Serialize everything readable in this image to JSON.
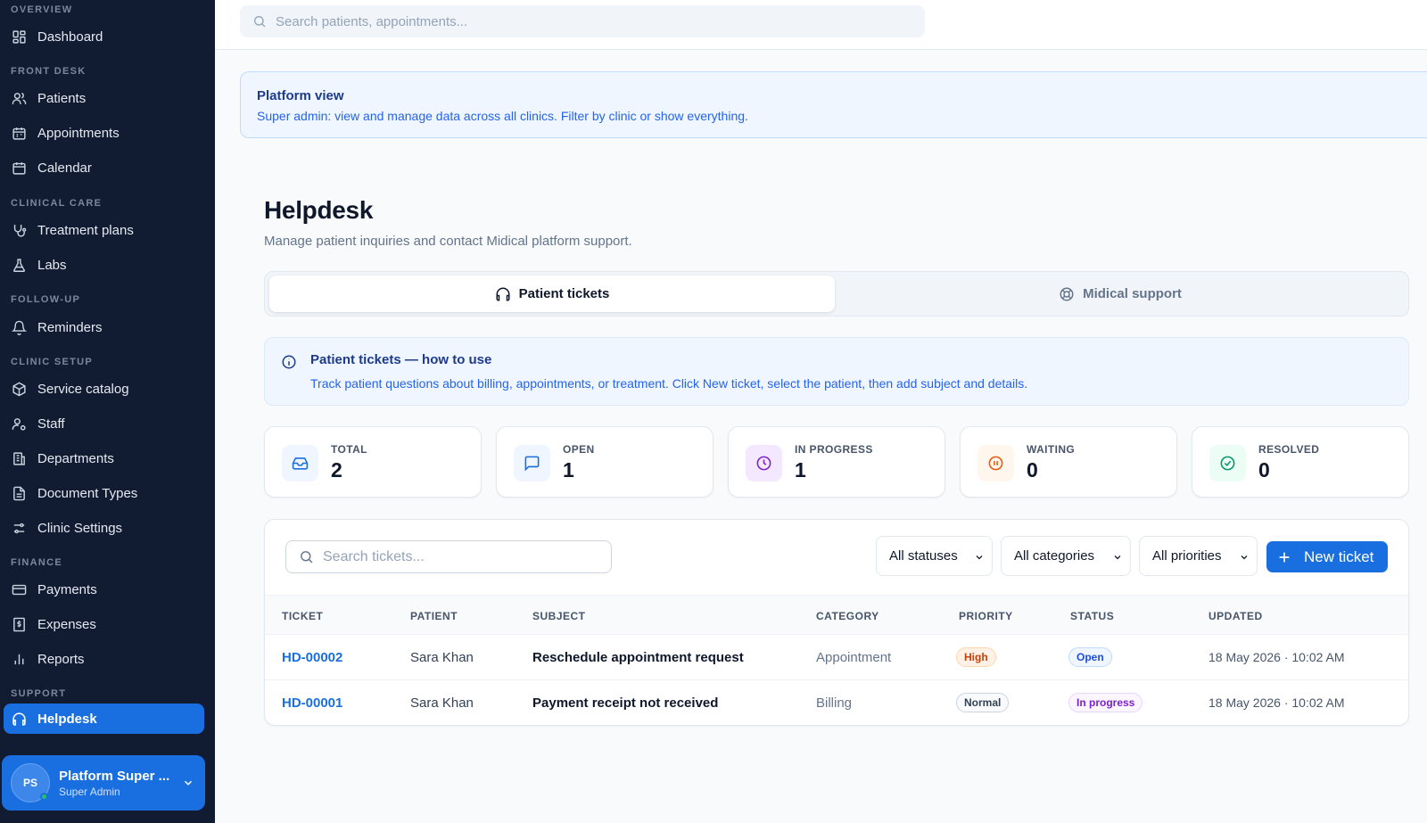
{
  "sidebar": {
    "sections": {
      "overview": "OVERVIEW",
      "front_desk": "FRONT DESK",
      "clinical_care": "CLINICAL CARE",
      "follow_up": "FOLLOW-UP",
      "clinic_setup": "CLINIC SETUP",
      "finance": "FINANCE",
      "support": "SUPPORT"
    },
    "items": {
      "dashboard": "Dashboard",
      "patients": "Patients",
      "appointments": "Appointments",
      "calendar": "Calendar",
      "treatment_plans": "Treatment plans",
      "labs": "Labs",
      "reminders": "Reminders",
      "service_catalog": "Service catalog",
      "staff": "Staff",
      "departments": "Departments",
      "document_types": "Document Types",
      "clinic_settings": "Clinic Settings",
      "payments": "Payments",
      "expenses": "Expenses",
      "reports": "Reports",
      "helpdesk": "Helpdesk"
    },
    "user": {
      "initials": "PS",
      "name": "Platform Super ...",
      "role": "Super Admin"
    }
  },
  "topbar": {
    "search_placeholder": "Search patients, appointments..."
  },
  "platform_banner": {
    "title": "Platform view",
    "description": "Super admin: view and manage data across all clinics. Filter by clinic or show everything."
  },
  "page": {
    "title": "Helpdesk",
    "subtitle": "Manage patient inquiries and contact Midical platform support."
  },
  "tabs": {
    "patient_tickets": "Patient tickets",
    "midical_support": "Midical support"
  },
  "info": {
    "title": "Patient tickets — how to use",
    "description": "Track patient questions about billing, appointments, or treatment. Click New ticket, select the patient, then add subject and details."
  },
  "stats": {
    "total": {
      "label": "TOTAL",
      "value": "2"
    },
    "open": {
      "label": "OPEN",
      "value": "1"
    },
    "in_progress": {
      "label": "IN PROGRESS",
      "value": "1"
    },
    "waiting": {
      "label": "WAITING",
      "value": "0"
    },
    "resolved": {
      "label": "RESOLVED",
      "value": "0"
    }
  },
  "toolbar": {
    "search_placeholder": "Search tickets...",
    "status_filter": "All statuses",
    "category_filter": "All categories",
    "priority_filter": "All priorities",
    "new_ticket": "New ticket"
  },
  "table": {
    "headers": {
      "ticket": "TICKET",
      "patient": "PATIENT",
      "subject": "SUBJECT",
      "category": "CATEGORY",
      "priority": "PRIORITY",
      "status": "STATUS",
      "updated": "UPDATED"
    },
    "rows": [
      {
        "ticket": "HD-00002",
        "patient": "Sara Khan",
        "subject": "Reschedule appointment request",
        "category": "Appointment",
        "priority": "High",
        "status": "Open",
        "updated": "18 May 2026 · 10:02 AM"
      },
      {
        "ticket": "HD-00001",
        "patient": "Sara Khan",
        "subject": "Payment receipt not received",
        "category": "Billing",
        "priority": "Normal",
        "status": "In progress",
        "updated": "18 May 2026 · 10:02 AM"
      }
    ]
  },
  "colors": {
    "sidebar_bg": "#111c33",
    "accent": "#1a6fe0",
    "priority_high": "#c2410c",
    "status_open": "#1d4ed8",
    "status_in_progress": "#7e22ce"
  }
}
